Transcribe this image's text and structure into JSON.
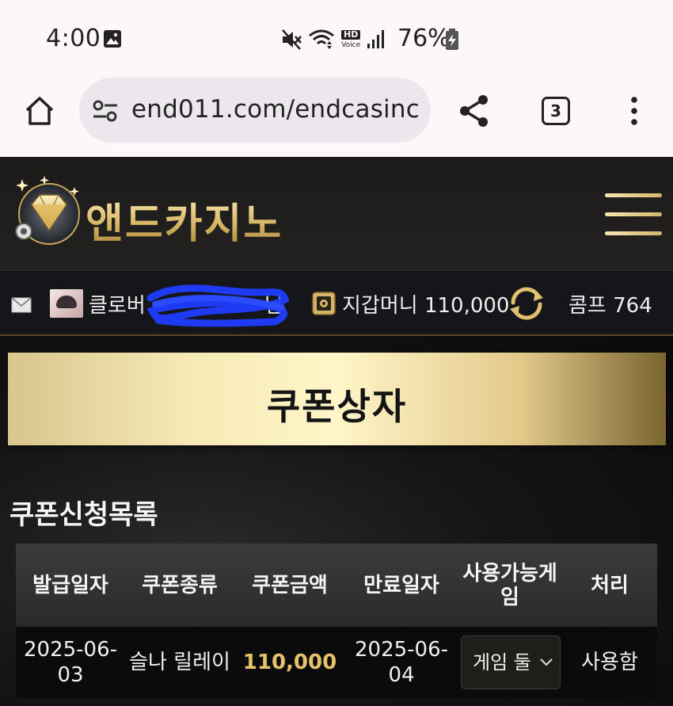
{
  "status_bar": {
    "time": "4:00",
    "battery": "76%",
    "network_label": "HD",
    "network_sub": "Voice",
    "icons": [
      "gallery-icon",
      "mute-icon",
      "wifi-icon",
      "hd-voice-icon",
      "signal-icon",
      "battery-charging-icon"
    ]
  },
  "browser": {
    "url": "end011.com/endcasinc",
    "tab_count": "3",
    "icons": [
      "home-icon",
      "site-settings-icon",
      "share-icon",
      "tabs-icon",
      "more-icon"
    ]
  },
  "site": {
    "brand": "앤드카지노",
    "user": {
      "name_visible": "클로버",
      "name_suffix": "님",
      "wallet": "지갑머니 110,000",
      "comp": "콤프 764"
    },
    "banner_title": "쿠폰상자",
    "section_title": "쿠폰신청목록",
    "table": {
      "headers": [
        "발급일자",
        "쿠폰종류",
        "쿠폰금액",
        "만료일자",
        "사용가능게임",
        "처리"
      ],
      "rows": [
        {
          "issue_date": "2025-06-03",
          "type": "슬나 릴레이",
          "amount": "110,000",
          "expire_date": "2025-06-04",
          "game_select": "게임 둘",
          "status": "사용함"
        }
      ]
    },
    "colors": {
      "gold": "#e6c36a",
      "background": "#0b0b0b",
      "header_bg": "#1c1b19"
    }
  }
}
